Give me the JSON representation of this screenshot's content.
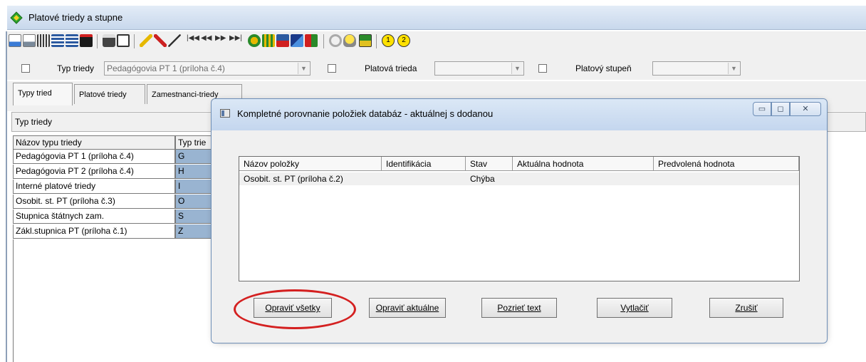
{
  "main_window": {
    "title": "Platové triedy a stupne"
  },
  "filters": {
    "typ_triedy": {
      "label": "Typ triedy",
      "value": "Pedagógovia PT 1 (príloha č.4)"
    },
    "platova_trieda": {
      "label": "Platová trieda",
      "value": ""
    },
    "platovy_stupen": {
      "label": "Platový stupeň",
      "value": ""
    }
  },
  "tabs": [
    {
      "label": "Typy tried"
    },
    {
      "label": "Platové triedy"
    },
    {
      "label": "Zamestnanci-triedy"
    }
  ],
  "panel": {
    "header": "Typ triedy"
  },
  "grid": {
    "columns": [
      "Názov typu triedy",
      "Typ trie"
    ],
    "rows": [
      {
        "name": "Pedagógovia PT 1 (príloha č.4)",
        "code": "G"
      },
      {
        "name": "Pedagógovia PT 2 (príloha č.4)",
        "code": "H"
      },
      {
        "name": "Interné platové triedy",
        "code": "I"
      },
      {
        "name": "Osobit. st. PT (príloha č.3)",
        "code": "O"
      },
      {
        "name": "Stupnica štátnych zam.",
        "code": "S"
      },
      {
        "name": "Zákl.stupnica PT (príloha č.1)",
        "code": "Z"
      }
    ]
  },
  "dialog": {
    "title": "Kompletné porovnanie položiek databáz - aktuálnej s dodanou",
    "window_buttons": {
      "minimize": "▭",
      "maximize": "◻",
      "close": "✕"
    },
    "list": {
      "columns": [
        "Názov položky",
        "Identifikácia",
        "Stav",
        "Aktuálna hodnota",
        "Predvolená hodnota"
      ],
      "rows": [
        {
          "nazov": "Osobit. st. PT (príloha č.2)",
          "identifikacia": "",
          "stav": "Chýba",
          "aktualna": "",
          "predvolena": ""
        }
      ]
    },
    "buttons": {
      "opravit_vsetky": "Opraviť všetky",
      "opravit_aktualne": "Opraviť aktuálne",
      "pozriet_text": "Pozrieť text",
      "vytlacit": "Vytlačiť",
      "zrusit": "Zrušiť"
    }
  },
  "toolbar_icons": [
    "insert-row-icon",
    "delete-row-icon",
    "grid-icon",
    "table-add-icon",
    "table-edit-icon",
    "table-delete-icon",
    "print-icon",
    "preview-icon",
    "filter-icon",
    "clear-filter-icon",
    "edit-icon",
    "first-icon",
    "prev-page-icon",
    "next-page-icon",
    "last-icon",
    "find-icon",
    "calc-icon",
    "export-icon",
    "report-icon",
    "copy-icon",
    "refresh-icon",
    "tips-icon",
    "check-icon",
    "one-icon",
    "two-icon"
  ],
  "colors": {
    "accent_code_cell": "#99b4d1",
    "highlight": "#d42020"
  }
}
